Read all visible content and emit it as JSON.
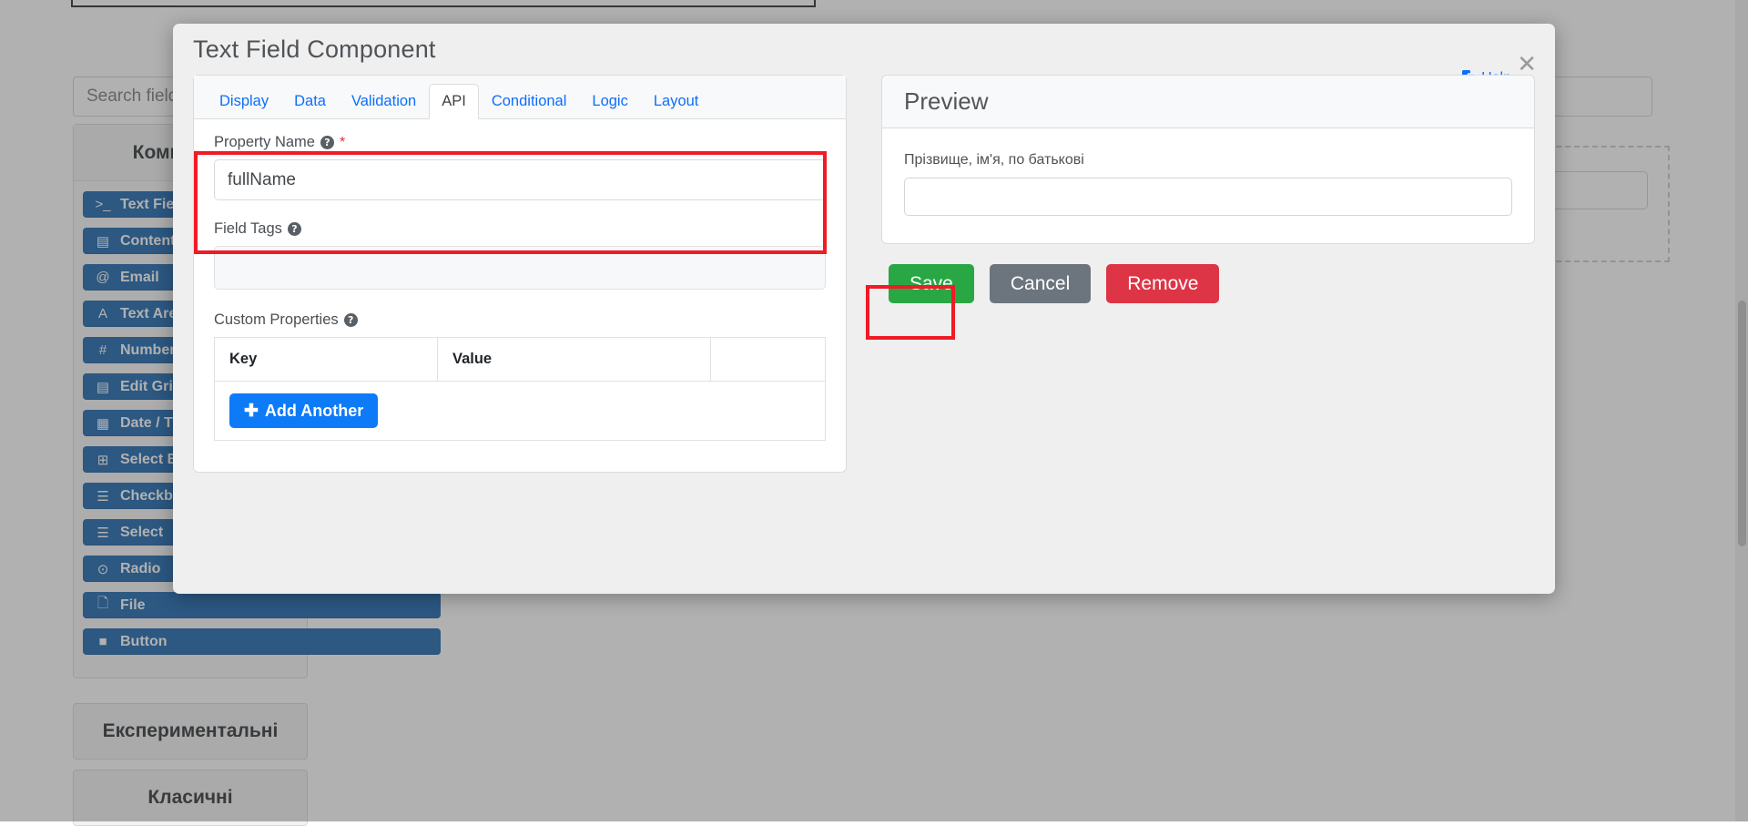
{
  "background": {
    "search_placeholder": "Search fields(s)",
    "palette_title": "Компоненти",
    "components": [
      {
        "label": "Text Field",
        "icon": "terminal-prompt-icon",
        "glyph": ">_"
      },
      {
        "label": "Content",
        "icon": "content-icon",
        "glyph": "▤"
      },
      {
        "label": "Email",
        "icon": "at-sign-icon",
        "glyph": "@"
      },
      {
        "label": "Text Area",
        "icon": "letter-a-icon",
        "glyph": "A"
      },
      {
        "label": "Number",
        "icon": "hash-icon",
        "glyph": "#"
      },
      {
        "label": "Edit Grid",
        "icon": "edit-grid-icon",
        "glyph": "▤"
      },
      {
        "label": "Date / Time",
        "icon": "calendar-icon",
        "glyph": "▦"
      },
      {
        "label": "Select Boxes",
        "icon": "plus-square-icon",
        "glyph": "⊞"
      },
      {
        "label": "Checkbox",
        "icon": "list-icon",
        "glyph": "☰"
      },
      {
        "label": "Select",
        "icon": "list-icon",
        "glyph": "☰"
      },
      {
        "label": "Radio",
        "icon": "radio-circle-icon",
        "glyph": "⊙"
      },
      {
        "label": "File",
        "icon": "file-icon",
        "glyph": "🗋"
      },
      {
        "label": "Button",
        "icon": "square-icon",
        "glyph": "■"
      }
    ],
    "sections": [
      {
        "label": "Експериментальні"
      },
      {
        "label": "Класичні"
      }
    ]
  },
  "modal": {
    "title": "Text Field Component",
    "help_label": "Help",
    "help_icon": "windows-help-icon",
    "close_icon": "close-icon",
    "tabs": [
      {
        "label": "Display",
        "active": false
      },
      {
        "label": "Data",
        "active": false
      },
      {
        "label": "Validation",
        "active": false
      },
      {
        "label": "API",
        "active": true
      },
      {
        "label": "Conditional",
        "active": false
      },
      {
        "label": "Logic",
        "active": false
      },
      {
        "label": "Layout",
        "active": false
      }
    ],
    "api_tab": {
      "property_name": {
        "label": "Property Name",
        "required_marker": "*",
        "help_icon": "question-mark-icon",
        "value": "fullName",
        "placeholder": ""
      },
      "field_tags": {
        "label": "Field Tags",
        "help_icon": "question-mark-icon",
        "value": "",
        "placeholder": ""
      },
      "custom_properties": {
        "label": "Custom Properties",
        "help_icon": "question-mark-icon",
        "columns": [
          "Key",
          "Value",
          ""
        ],
        "rows": [],
        "add_button_label": "Add Another",
        "add_button_icon": "plus-icon"
      }
    },
    "preview": {
      "title": "Preview",
      "field_label": "Прізвище, ім'я, по батькові",
      "field_value": "",
      "field_placeholder": ""
    },
    "actions": {
      "save_label": "Save",
      "cancel_label": "Cancel",
      "remove_label": "Remove"
    }
  },
  "annotations": [
    {
      "name": "property-name-highlight",
      "color": "#ef1b25"
    },
    {
      "name": "save-button-highlight",
      "color": "#ef1b25"
    }
  ],
  "colors": {
    "accent_blue": "#0d6efd",
    "add_button_blue": "#0d7bf7",
    "palette_blue": "#0b5ca8",
    "save_green": "#2aa745",
    "cancel_gray": "#6c757d",
    "remove_red": "#dd3545",
    "required_red": "#dc3545",
    "annotation_red": "#ef1b25"
  }
}
